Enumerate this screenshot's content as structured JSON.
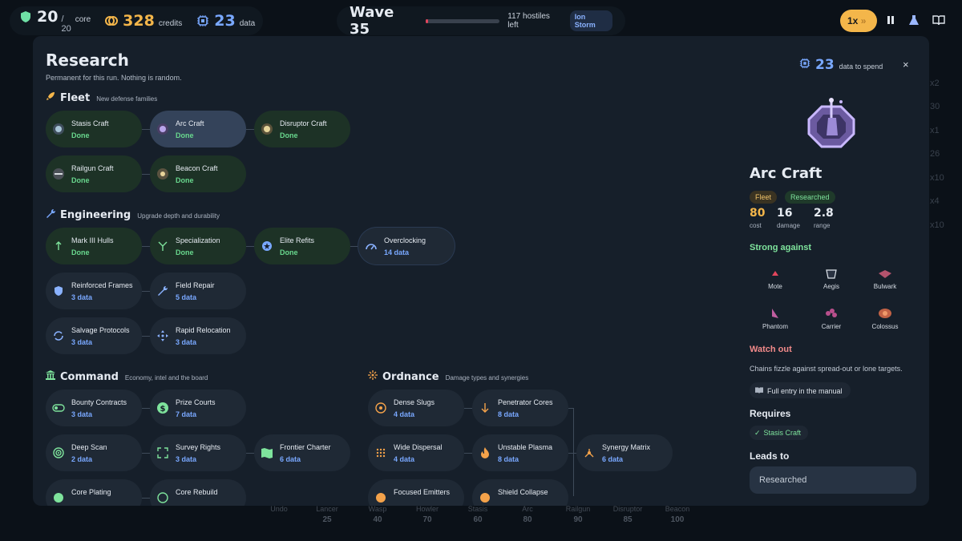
{
  "hud": {
    "core": "20",
    "core_max": "/ 20",
    "core_label": "core",
    "credits": "328",
    "credits_label": "credits",
    "data": "23",
    "data_label": "data",
    "icons": [
      "shield-icon",
      "coins-icon",
      "chip-icon"
    ]
  },
  "wave": {
    "title": "Wave 35",
    "progress": 0.03,
    "hostiles": "117 hostiles left",
    "modifier": "Ion Storm"
  },
  "controls": {
    "speed": "1x",
    "icons": [
      "fast-forward-icon",
      "pause-icon",
      "flask-icon",
      "manual-book-icon"
    ]
  },
  "colors": {
    "accent_gold": "#f4b64a",
    "accent_blue": "#79a8ff",
    "accent_green": "#7ee39c",
    "accent_red": "#f28a8a",
    "modal_bg": "#161f2a"
  },
  "research": {
    "title": "Research",
    "subtitle": "Permanent for this run. Nothing is random.",
    "sections": {
      "fleet": {
        "title": "Fleet",
        "desc": "New defense families"
      },
      "engineering": {
        "title": "Engineering",
        "desc": "Upgrade depth and durability"
      },
      "command": {
        "title": "Command",
        "desc": "Economy, intel and the board"
      },
      "ordnance": {
        "title": "Ordnance",
        "desc": "Damage types and synergies"
      }
    },
    "fleet": [
      {
        "name": "Stasis Craft",
        "status": "Done"
      },
      {
        "name": "Arc Craft",
        "status": "Done"
      },
      {
        "name": "Disruptor Craft",
        "status": "Done"
      },
      {
        "name": "Railgun Craft",
        "status": "Done"
      },
      {
        "name": "Beacon Craft",
        "status": "Done"
      }
    ],
    "engineering": [
      {
        "name": "Mark III Hulls",
        "status": "Done"
      },
      {
        "name": "Specialization",
        "status": "Done"
      },
      {
        "name": "Elite Refits",
        "status": "Done"
      },
      {
        "name": "Overclocking",
        "status": "14 data"
      },
      {
        "name": "Reinforced Frames",
        "status": "3 data"
      },
      {
        "name": "Field Repair",
        "status": "5 data"
      },
      {
        "name": "Salvage Protocols",
        "status": "3 data"
      },
      {
        "name": "Rapid Relocation",
        "status": "3 data"
      }
    ],
    "command": [
      {
        "name": "Bounty Contracts",
        "status": "3 data"
      },
      {
        "name": "Prize Courts",
        "status": "7 data"
      },
      {
        "name": "Deep Scan",
        "status": "2 data"
      },
      {
        "name": "Survey Rights",
        "status": "3 data"
      },
      {
        "name": "Frontier Charter",
        "status": "6 data"
      },
      {
        "name": "Core Plating"
      },
      {
        "name": "Core Rebuild"
      }
    ],
    "ordnance": [
      {
        "name": "Dense Slugs",
        "status": "4 data"
      },
      {
        "name": "Penetrator Cores",
        "status": "8 data"
      },
      {
        "name": "Wide Dispersal",
        "status": "4 data"
      },
      {
        "name": "Unstable Plasma",
        "status": "8 data"
      },
      {
        "name": "Synergy Matrix",
        "status": "6 data"
      },
      {
        "name": "Focused Emitters"
      },
      {
        "name": "Shield Collapse"
      }
    ]
  },
  "detail": {
    "data_value": "23",
    "data_label": "data to spend",
    "close": "×",
    "title": "Arc Craft",
    "tags": [
      "Fleet",
      "Researched"
    ],
    "stats": [
      {
        "value": "80",
        "label": "cost"
      },
      {
        "value": "16",
        "label": "damage"
      },
      {
        "value": "2.8",
        "label": "range"
      }
    ],
    "strong_against_label": "Strong against",
    "strong_against": [
      "Mote",
      "Aegis",
      "Bulwark",
      "Phantom",
      "Carrier",
      "Colossus"
    ],
    "watch_out_label": "Watch out",
    "watch_out_text": "Chains fizzle against spread-out or lone targets.",
    "manual_link": "Full entry in the manual",
    "requires_label": "Requires",
    "requires": [
      "Stasis Craft"
    ],
    "leads_to_label": "Leads to",
    "action_button": "Researched"
  },
  "build_bar": [
    {
      "name": "Undo"
    },
    {
      "name": "Lancer",
      "cost": "25"
    },
    {
      "name": "Wasp",
      "cost": "40"
    },
    {
      "name": "Howler",
      "cost": "70"
    },
    {
      "name": "Stasis",
      "cost": "60"
    },
    {
      "name": "Arc",
      "cost": "80"
    },
    {
      "name": "Railgun",
      "cost": "90"
    },
    {
      "name": "Disruptor",
      "cost": "85"
    },
    {
      "name": "Beacon",
      "cost": "100"
    }
  ],
  "ghost": {
    "side": [
      "x2",
      "30",
      "x1",
      "26",
      "x10",
      "x4",
      "x10"
    ]
  }
}
